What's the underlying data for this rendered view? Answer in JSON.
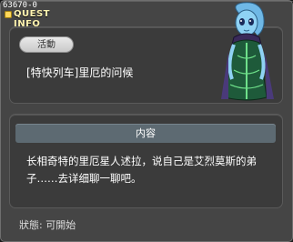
{
  "window": {
    "id_text": "63670-0",
    "title": "QUEST INFO"
  },
  "quest": {
    "category_badge": "活動",
    "title": "[特快列车]里厄的问候"
  },
  "content": {
    "header": "内容",
    "description": "长相奇特的里厄星人述拉，说自己是艾烈莫斯的弟子……去详细聊一聊吧。"
  },
  "status": {
    "text": "狀態:  可開始"
  },
  "npc": {
    "icon": "alien-npc-portrait",
    "colors": {
      "skin": "#7ec8f0",
      "dress": "#1e5a3a",
      "trim": "#6ee08a"
    }
  }
}
